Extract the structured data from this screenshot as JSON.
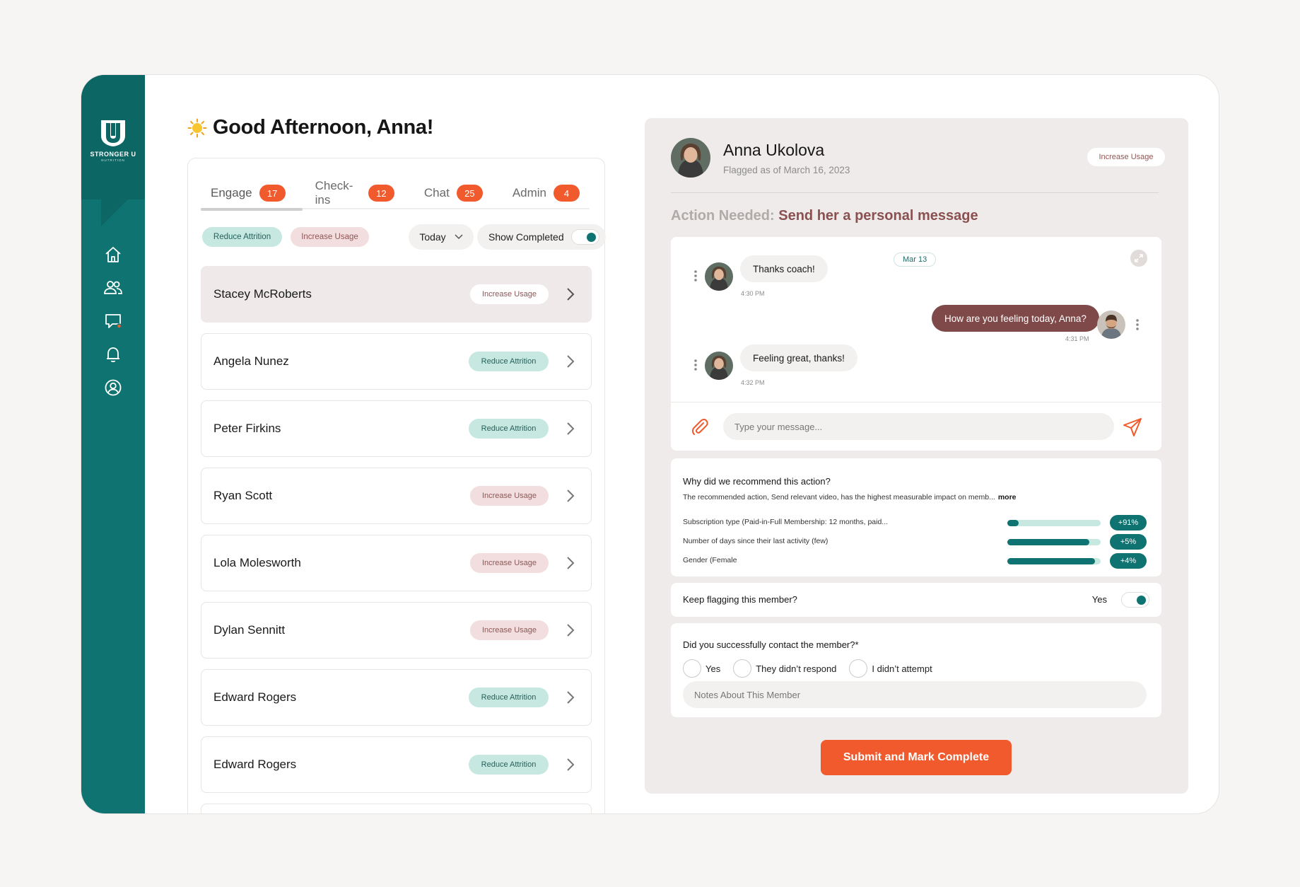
{
  "brand": {
    "name": "STRONGER U",
    "sub": "NUTRITION"
  },
  "colors": {
    "primary": "#0f7471",
    "accent": "#f15a2d",
    "maroon": "#7f4949",
    "tag_teal_bg": "#c6e8e1",
    "tag_pink_bg": "#f2dede"
  },
  "nav": [
    {
      "icon": "home-icon"
    },
    {
      "icon": "members-icon"
    },
    {
      "icon": "chat-icon"
    },
    {
      "icon": "bell-icon"
    },
    {
      "icon": "account-icon"
    }
  ],
  "greeting": "Good Afternoon, Anna!",
  "tabs": [
    {
      "label": "Engage",
      "count": "17"
    },
    {
      "label": "Check-ins",
      "count": "12"
    },
    {
      "label": "Chat",
      "count": "25"
    },
    {
      "label": "Admin",
      "count": "4"
    }
  ],
  "filters": {
    "reduce_attrition": "Reduce Attrition",
    "increase_usage": "Increase Usage",
    "date_select": "Today",
    "show_completed": "Show Completed"
  },
  "members": [
    {
      "name": "Stacey McRoberts",
      "tag": "Increase Usage",
      "tag_type": "white",
      "selected": true
    },
    {
      "name": "Angela Nunez",
      "tag": "Reduce Attrition",
      "tag_type": "teal"
    },
    {
      "name": "Peter Firkins",
      "tag": "Reduce Attrition",
      "tag_type": "teal"
    },
    {
      "name": "Ryan Scott",
      "tag": "Increase Usage",
      "tag_type": "pink"
    },
    {
      "name": "Lola Molesworth",
      "tag": "Increase Usage",
      "tag_type": "pink"
    },
    {
      "name": "Dylan Sennitt",
      "tag": "Increase Usage",
      "tag_type": "pink"
    },
    {
      "name": "Edward Rogers",
      "tag": "Reduce Attrition",
      "tag_type": "teal"
    },
    {
      "name": "Edward Rogers",
      "tag": "Reduce Attrition",
      "tag_type": "teal"
    }
  ],
  "detail": {
    "name": "Anna Ukolova",
    "flagged": "Flagged as of March 16, 2023",
    "tag": "Increase Usage",
    "action_prefix": "Action Needed:",
    "action_text": "Send her a personal message",
    "chat": {
      "date": "Mar 13",
      "messages": [
        {
          "text": "Thanks coach!",
          "time": "4:30 PM"
        },
        {
          "text": "How are you feeling today, Anna?",
          "time": "4:31 PM"
        },
        {
          "text": "Feeling great, thanks!",
          "time": "4:32 PM"
        }
      ],
      "placeholder": "Type your message..."
    },
    "why": {
      "title": "Why did we recommend this action?",
      "desc": "The recommended action, Send relevant video, has the highest measurable impact on memb...",
      "more": "more",
      "factors": [
        {
          "label": "Subscription type (Paid-in-Full Membership: 12 months, paid...",
          "level": 0.12,
          "value": "+91%"
        },
        {
          "label": "Number of days since their last activity (few)",
          "level": 0.88,
          "value": "+5%"
        },
        {
          "label": "Gender (Female",
          "level": 0.94,
          "value": "+4%"
        }
      ]
    },
    "keep_flagging": {
      "label": "Keep flagging this member?",
      "value": "Yes"
    },
    "contact": {
      "title": "Did you successfully contact the member?*",
      "options": [
        "Yes",
        "They didn’t respond",
        "I didn’t attempt"
      ],
      "notes_placeholder": "Notes About This Member"
    },
    "submit": "Submit and Mark Complete"
  }
}
